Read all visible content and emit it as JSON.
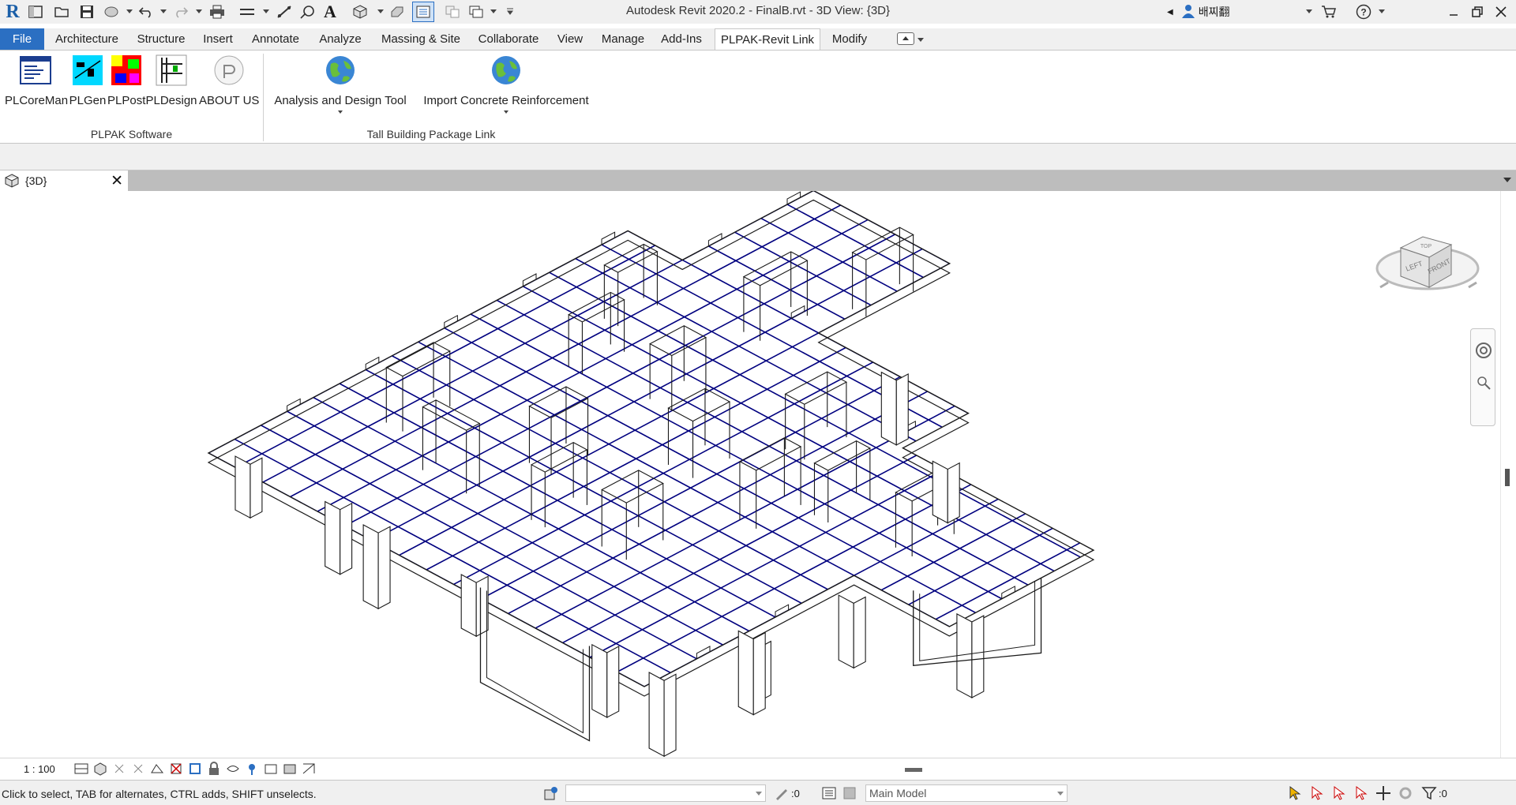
{
  "app": {
    "title": "Autodesk Revit 2020.2 - FinalB.rvt - 3D View: {3D}",
    "user_name": "배찌翻",
    "logo_letter": "R"
  },
  "quick_access": [
    "open-icon",
    "save-icon",
    "sync-icon",
    "undo-icon",
    "redo-icon",
    "print-icon",
    "measure-icon",
    "dimension-icon",
    "tag-icon",
    "text-icon",
    "3d-view-icon",
    "section-icon",
    "thin-lines-icon",
    "close-hidden-icon",
    "switch-windows-icon"
  ],
  "ribbon_tabs": [
    {
      "label": "File"
    },
    {
      "label": "Architecture"
    },
    {
      "label": "Structure"
    },
    {
      "label": "Insert"
    },
    {
      "label": "Annotate"
    },
    {
      "label": "Analyze"
    },
    {
      "label": "Massing & Site"
    },
    {
      "label": "Collaborate"
    },
    {
      "label": "View"
    },
    {
      "label": "Manage"
    },
    {
      "label": "Add-Ins"
    },
    {
      "label": "PLPAK-Revit Link"
    },
    {
      "label": "Modify"
    }
  ],
  "ribbon": {
    "buttons": [
      {
        "label": "PLCoreMan"
      },
      {
        "label": "PLGen"
      },
      {
        "label": "PLPost"
      },
      {
        "label": "PLDesign"
      },
      {
        "label": "ABOUT US"
      },
      {
        "label": "Analysis and Design Tool"
      },
      {
        "label": "Import Concrete Reinforcement"
      }
    ],
    "panels": [
      {
        "label": "PLPAK Software"
      },
      {
        "label": "Tall Building Package Link"
      }
    ]
  },
  "document_tab": {
    "title": "{3D}"
  },
  "view_cube": {
    "faces": [
      "TOP",
      "LEFT",
      "FRONT"
    ]
  },
  "view_control": {
    "scale": "1 : 100"
  },
  "status": {
    "text": "Click to select, TAB for alternates, CTRL adds, SHIFT unselects.",
    "workset_value": "",
    "select_count": ":0",
    "model_value": "Main Model",
    "filter_count": ":0"
  },
  "colors": {
    "accent": "#2b6fc2",
    "reinforcement": "#00007f",
    "model_lines": "#1a1a1a"
  }
}
